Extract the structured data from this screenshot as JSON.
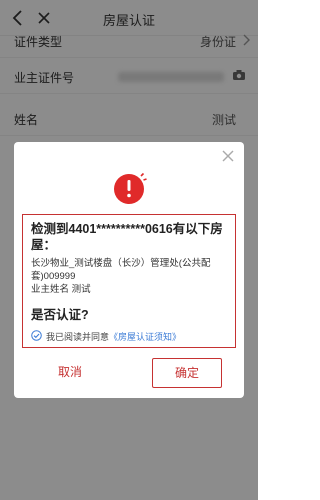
{
  "header": {
    "title": "房屋认证"
  },
  "form": {
    "rows": [
      {
        "label": "证件类型",
        "value": "身份证"
      },
      {
        "label": "业主证件号",
        "value": ""
      },
      {
        "label": "姓名",
        "value": "测试"
      }
    ]
  },
  "dialog": {
    "title": "检测到4401**********0616有以下房屋：",
    "property": "长沙物业_测试楼盘（长沙）管理处(公共配套)009999",
    "owner_label": "业主姓名",
    "owner_name": "测试",
    "question": "是否认证?",
    "agree_text": "我已阅读并同意",
    "agree_link": "《房屋认证须知》",
    "cancel_label": "取消",
    "confirm_label": "确定"
  },
  "colors": {
    "accent": "#c63232",
    "link": "#3b7bd6"
  }
}
